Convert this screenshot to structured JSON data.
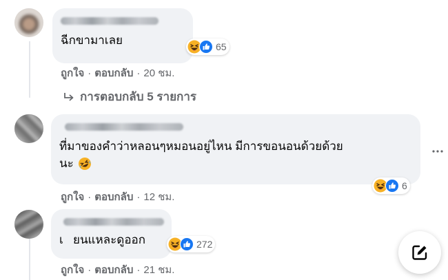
{
  "comments": [
    {
      "text": "ฉีกขามาเลย",
      "reaction_count": "65",
      "like_label": "ถูกใจ",
      "reply_label": "ตอบกลับ",
      "time": "20 ชม.",
      "replies_label": "การตอบกลับ 5 รายการ"
    },
    {
      "text_line1": "ที่มาของคำว่าหลอนๆหมอนอยู่ไหน มีการขอนอนด้วยด้วย",
      "text_line2": "นะ",
      "reaction_count": "6",
      "like_label": "ถูกใจ",
      "reply_label": "ตอบกลับ",
      "time": "12 ชม."
    },
    {
      "text": "เ   ยนแหละดูออก",
      "reaction_count": "272",
      "like_label": "ถูกใจ",
      "reply_label": "ตอบกลับ",
      "time": "21 ชม."
    }
  ],
  "separator": "·",
  "icons": {
    "reaction_haha": "haha-emoji-icon",
    "reaction_like": "like-thumb-icon",
    "inline_emoji": "rolling-laughing-emoji-icon",
    "reply_arrow": "reply-arrow-icon",
    "more": "more-options-icon",
    "compose": "compose-edit-icon"
  },
  "colors": {
    "bubble": "#f0f2f5",
    "secondary_text": "#65676b",
    "like_blue": "#1877f2",
    "haha_yellow": "#f7b125"
  }
}
